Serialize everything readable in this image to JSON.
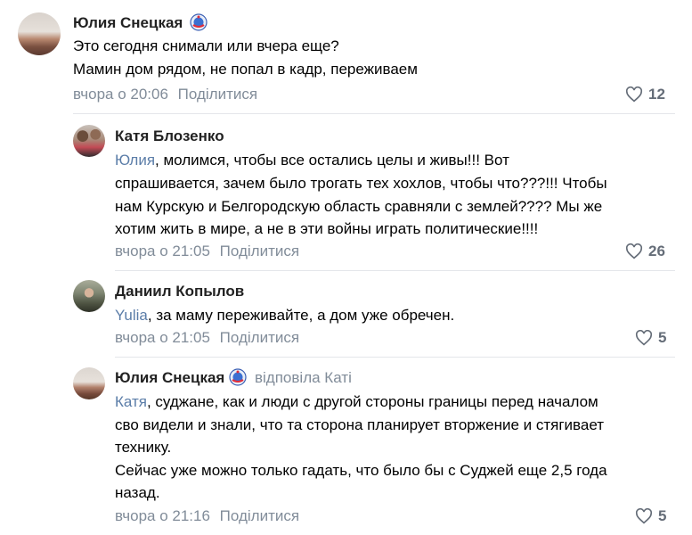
{
  "colors": {
    "link": "#5b7da8",
    "meta": "#818c99",
    "divider": "#e4e6ea"
  },
  "comments": [
    {
      "author": "Юлия Снецкая",
      "badge_icon": "badge-icon",
      "lines": [
        "Это сегодня снимали или вчера еще?",
        "Мамин дом рядом, не попал в кадр, переживаем"
      ],
      "time": "вчора о 20:06",
      "share": "Поділитися",
      "likes": "12"
    },
    {
      "author": "Катя Блозенко",
      "mention": "Юлия",
      "line1_rest": ", молимся, чтобы все остались целы и живы!!! Вот",
      "lines": [
        "спрашивается, зачем было трогать тех хохлов, чтобы что???!!! Чтобы",
        "нам Курскую и Белгородскую область сравняли с землей???? Мы же",
        "хотим жить в мире, а не в эти войны играть политические!!!!"
      ],
      "time": "вчора о 21:05",
      "share": "Поділитися",
      "likes": "26"
    },
    {
      "author": "Даниил Копылов",
      "mention": "Yulia",
      "line1_rest": ", за маму переживайте, а дом уже обречен.",
      "time": "вчора о 21:05",
      "share": "Поділитися",
      "likes": "5"
    },
    {
      "author": "Юлия Снецкая",
      "reply_to": "відповіла Каті",
      "mention": "Катя",
      "line1_rest": ", суджане, как и люди с другой стороны границы перед началом",
      "lines": [
        "сво видели и знали, что та сторона планирует вторжение и стягивает",
        "технику.",
        "Сейчас уже можно только гадать, что было бы с Суджей еще 2,5 года",
        "назад."
      ],
      "time": "вчора о 21:16",
      "share": "Поділитися",
      "likes": "5"
    }
  ]
}
